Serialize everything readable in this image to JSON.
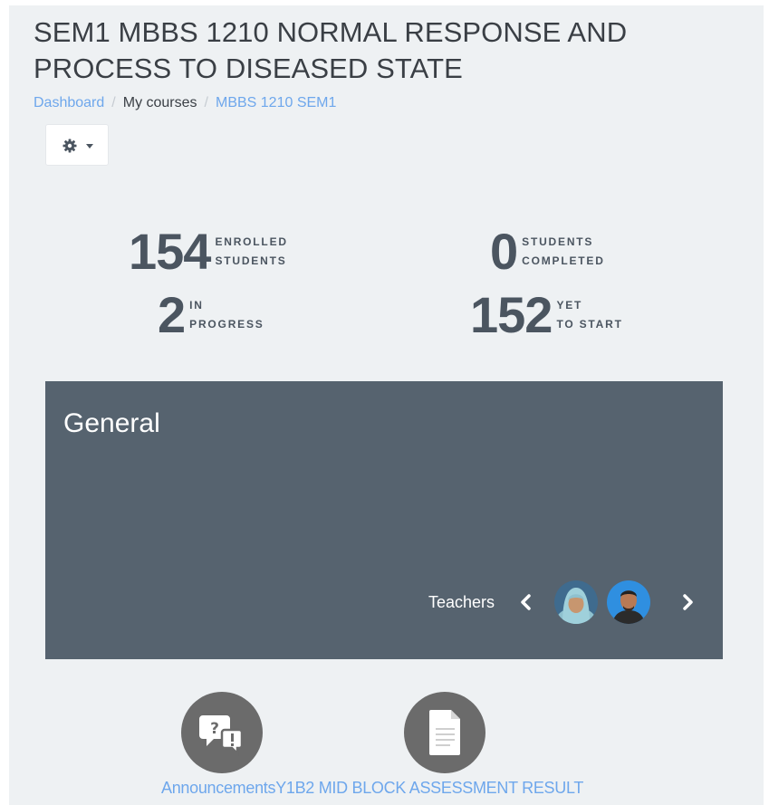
{
  "course": {
    "title": "SEM1 MBBS 1210 NORMAL RESPONSE AND PROCESS TO DISEASED STATE"
  },
  "breadcrumb": {
    "items": [
      "Dashboard",
      "My courses",
      "MBBS 1210 SEM1"
    ],
    "separator": "/"
  },
  "settings_menu": {
    "icon": "gear-icon",
    "caret_icon": "caret-down-icon"
  },
  "stats": {
    "enrolled": {
      "value": "154",
      "label_line1": "ENROLLED",
      "label_line2": "STUDENTS"
    },
    "completed": {
      "value": "0",
      "label_line1": "STUDENTS",
      "label_line2": "COMPLETED"
    },
    "in_progress": {
      "value": "2",
      "label_line1": "IN",
      "label_line2": "PROGRESS"
    },
    "yet_to_start": {
      "value": "152",
      "label_line1": "YET",
      "label_line2": "TO START"
    }
  },
  "section": {
    "title": "General",
    "teachers_label": "Teachers",
    "teachers": [
      {
        "avatar": "teacher-avatar-female"
      },
      {
        "avatar": "teacher-avatar-male"
      }
    ]
  },
  "activities": [
    {
      "name": "Announcements",
      "icon": "forum-icon"
    },
    {
      "name": "Y1B2 MID BLOCK ASSESSMENT RESULT",
      "icon": "file-icon"
    }
  ],
  "colors": {
    "page_background": "#eef1f3",
    "section_background": "#56636f",
    "link": "#6ea7ec",
    "stat_text": "#4b5560",
    "activity_icon_background": "#6b6b6b"
  }
}
